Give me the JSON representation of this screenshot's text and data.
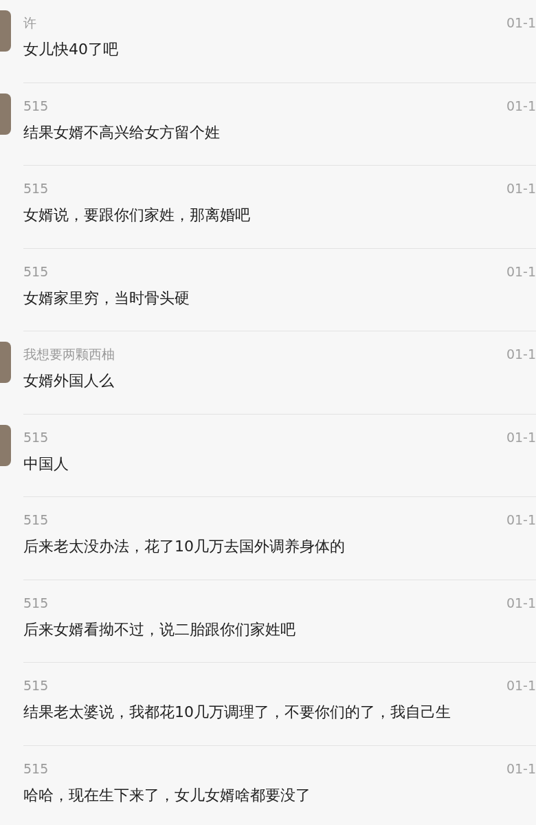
{
  "messages": [
    {
      "has_avatar": true,
      "sender": "许",
      "time": "01-1",
      "text": "女儿快40了吧"
    },
    {
      "has_avatar": true,
      "sender": "515",
      "time": "01-1",
      "text": "结果女婿不高兴给女方留个姓"
    },
    {
      "has_avatar": false,
      "sender": "515",
      "time": "01-1",
      "text": "女婿说，要跟你们家姓，那离婚吧"
    },
    {
      "has_avatar": false,
      "sender": "515",
      "time": "01-1",
      "text": "女婿家里穷，当时骨头硬"
    },
    {
      "has_avatar": true,
      "sender": "我想要两颗西柚",
      "time": "01-1",
      "text": "女婿外国人么"
    },
    {
      "has_avatar": true,
      "sender": "515",
      "time": "01-1",
      "text": "中国人"
    },
    {
      "has_avatar": false,
      "sender": "515",
      "time": "01-1",
      "text": "后来老太没办法，花了10几万去国外调养身体的"
    },
    {
      "has_avatar": false,
      "sender": "515",
      "time": "01-1",
      "text": "后来女婿看拗不过，说二胎跟你们家姓吧"
    },
    {
      "has_avatar": false,
      "sender": "515",
      "time": "01-1",
      "text": "结果老太婆说，我都花10几万调理了，不要你们的了，我自己生"
    },
    {
      "has_avatar": false,
      "sender": "515",
      "time": "01-1",
      "text": "哈哈，现在生下来了，女儿女婿啥都要没了"
    }
  ]
}
